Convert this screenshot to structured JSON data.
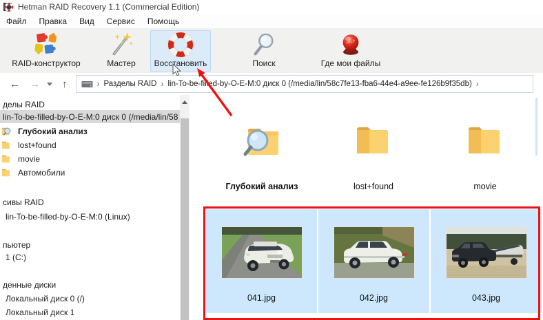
{
  "window": {
    "title": "Hetman RAID Recovery 1.1 (Commercial Edition)",
    "app_icon": "lifebuoy-app-icon"
  },
  "menu": {
    "items": [
      "Файл",
      "Правка",
      "Вид",
      "Сервис",
      "Помощь"
    ]
  },
  "toolbar": {
    "buttons": [
      {
        "label": "RAID-конструктор",
        "icon": "puzzle-pieces-icon",
        "active": false
      },
      {
        "label": "Мастер",
        "icon": "magic-wand-icon",
        "active": false
      },
      {
        "label": "Восстановить",
        "icon": "lifebuoy-icon",
        "active": true
      },
      {
        "label": "Поиск",
        "icon": "magnifier-icon",
        "active": false
      },
      {
        "label": "Где мои файлы",
        "icon": "red-help-button-icon",
        "active": false
      }
    ]
  },
  "address_bar": {
    "nav": [
      "back-arrow",
      "forward-arrow",
      "history-chevron",
      "up-arrow"
    ],
    "crumbs": [
      "Разделы RAID",
      "lin-To-be-filled-by-O-E-M:0 диск 0 (/media/lin/58c7fe13-fba6-44e4-a9ee-fe126b9f35db)"
    ]
  },
  "sidebar": {
    "raid_partitions_header": "делы RAID",
    "selected_disk": "lin-To-be-filled-by-O-E-M:0 диск 0 (/media/lin/58",
    "deep_scan_label": "Глубокий анализ",
    "folder_items": [
      "lost+found",
      "movie",
      "Автомобили"
    ],
    "raid_arrays_header": "сивы RAID",
    "raid_array_item": "lin-To-be-filled-by-O-E-M:0 (Linux)",
    "computer_header": "пьютер",
    "computer_item": "1 (C:)",
    "found_disks_header": "денные диски",
    "found_disk_items": [
      "Локальный диск 0 (/)",
      "Локальный диск 1"
    ]
  },
  "main": {
    "folders": [
      {
        "label": "Глубокий анализ",
        "icon": "deep-scan-folder-icon"
      },
      {
        "label": "lost+found",
        "icon": "folder-icon"
      },
      {
        "label": "movie",
        "icon": "folder-icon"
      }
    ],
    "files": [
      {
        "label": "041.jpg",
        "icon": "thumbnail-white-suv-road"
      },
      {
        "label": "042.jpg",
        "icon": "thumbnail-white-suv-side"
      },
      {
        "label": "043.jpg",
        "icon": "thumbnail-black-suv-boat"
      }
    ]
  },
  "colors": {
    "selection_blue": "#cde8fc",
    "active_button_bg": "#dcebfa",
    "sidebar_selected_bg": "#d9d9d9",
    "annotation_red": "#ee1111",
    "folder_yellow": "#fcd270"
  }
}
